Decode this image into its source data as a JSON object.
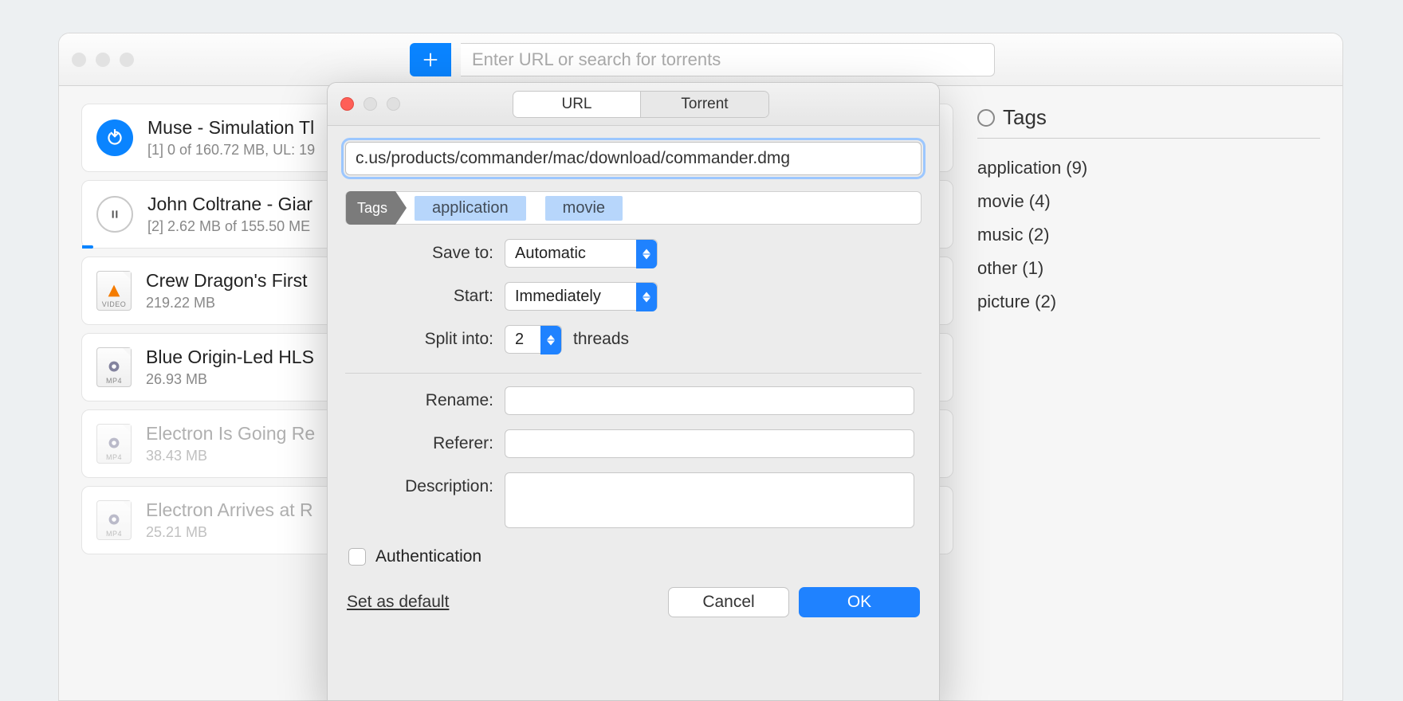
{
  "toolbar": {
    "search_placeholder": "Enter URL or search for torrents"
  },
  "downloads": [
    {
      "title": "Muse - Simulation Tl",
      "sub": "[1] 0 of 160.72 MB, UL: 19",
      "icon": "seed"
    },
    {
      "title": "John Coltrane - Giar",
      "sub": "[2] 2.62 MB of 155.50 ME",
      "icon": "pause",
      "progressing": true
    },
    {
      "title": "Crew Dragon's First",
      "sub": "219.22 MB",
      "icon": "vlc"
    },
    {
      "title": "Blue Origin-Led HLS",
      "sub": "26.93 MB",
      "icon": "mp4"
    },
    {
      "title": "Electron Is Going Re",
      "sub": "38.43 MB",
      "icon": "mp4",
      "dim": true
    },
    {
      "title": "Electron Arrives at R",
      "sub": "25.21 MB",
      "icon": "mp4",
      "dim": true
    }
  ],
  "tags_sidebar": {
    "header": "Tags",
    "items": [
      "application (9)",
      "movie (4)",
      "music (2)",
      "other (1)",
      "picture (2)"
    ]
  },
  "sheet": {
    "tabs": {
      "url": "URL",
      "torrent": "Torrent"
    },
    "url_value": "c.us/products/commander/mac/download/commander.dmg",
    "tags_label": "Tags",
    "tag_chips": [
      "application",
      "movie"
    ],
    "labels": {
      "save_to": "Save to:",
      "start": "Start:",
      "split_into": "Split into:",
      "threads_suffix": "threads",
      "rename": "Rename:",
      "referer": "Referer:",
      "description": "Description:",
      "authentication": "Authentication",
      "set_default": "Set as default",
      "cancel": "Cancel",
      "ok": "OK"
    },
    "values": {
      "save_to": "Automatic",
      "start": "Immediately",
      "split_into": "2"
    }
  }
}
